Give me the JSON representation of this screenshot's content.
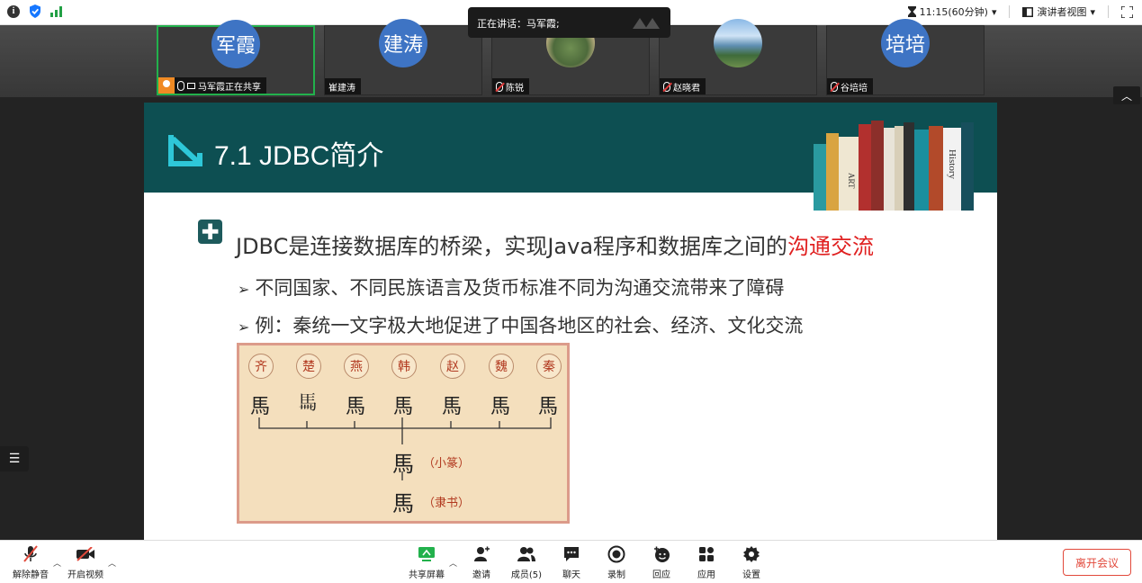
{
  "topbar": {
    "time_label": "11:15(60分钟)",
    "view_label": "演讲者视图",
    "icons": [
      "info-icon",
      "shield-icon",
      "signal-icon",
      "hourglass-icon",
      "presenter-view-icon",
      "fullscreen-icon"
    ]
  },
  "speaking": {
    "text": "正在讲话：马军霞;"
  },
  "participants": [
    {
      "avatar_text": "军霞",
      "name": "马军霞正在共享",
      "active": true
    },
    {
      "avatar_text": "建涛",
      "name": "崔建涛"
    },
    {
      "avatar_text": "",
      "name": "陈锐"
    },
    {
      "avatar_text": "",
      "name": "赵晓君"
    },
    {
      "avatar_text": "培培",
      "name": "谷培培"
    }
  ],
  "slide": {
    "title": "7.1 JDBC简介",
    "main_text": "JDBC是连接数据库的桥梁，实现Java程序和数据库之间的",
    "main_highlight": "沟通交流",
    "sub1": "不同国家、不同民族语言及货币标准不同为沟通交流带来了障碍",
    "sub2": "例：秦统一文字极大地促进了中国各地区的社会、经济、文化交流",
    "bullet": "➢",
    "books": {
      "art": "ART",
      "history": "History"
    },
    "figure": {
      "states": [
        "齐",
        "楚",
        "燕",
        "韩",
        "赵",
        "魏",
        "秦"
      ],
      "scripts": [
        "馬",
        "𩡧",
        "馬",
        "馬",
        "馬",
        "馬",
        "馬"
      ],
      "xiaozhuan_glyph": "馬",
      "xiaozhuan_caption": "（小篆）",
      "lishu_glyph": "馬",
      "lishu_caption": "（隶书）"
    }
  },
  "toolbar": {
    "unmute": "解除静音",
    "start_video": "开启视频",
    "share": "共享屏幕",
    "invite": "邀请",
    "members": "成员(5)",
    "chat": "聊天",
    "record": "录制",
    "react": "回应",
    "apps": "应用",
    "settings": "设置",
    "leave": "离开会议"
  },
  "colors": {
    "slide_header": "#0d4f52",
    "accent_red": "#e02020",
    "share_green": "#22b14c",
    "leave_red": "#e2493b"
  }
}
